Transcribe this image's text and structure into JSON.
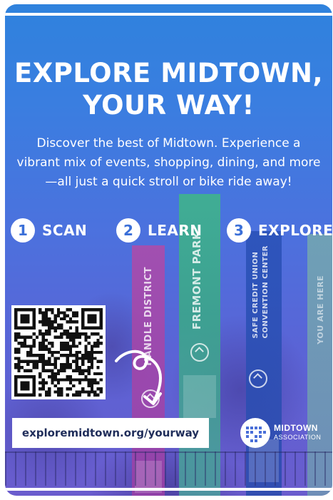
{
  "poster": {
    "title_line1": "EXPLORE MIDTOWN,",
    "title_line2": "YOUR WAY!",
    "subtitle": "Discover the best of Midtown. Experience a vibrant mix of events, shopping, dining, and more—all just a quick stroll or bike ride away!",
    "steps": [
      {
        "number": "1",
        "label": "SCAN"
      },
      {
        "number": "2",
        "label": "LEARN"
      },
      {
        "number": "3",
        "label": "EXPLORE"
      }
    ],
    "url": "exploremidtown.org/yourway",
    "logo": {
      "name": "MIDTOWN",
      "sub": "ASSOCIATION",
      "icon": "midtown-logo-icon"
    },
    "qr_icon": "qr-code",
    "arrow_icon": "curly-arrow-icon"
  },
  "background_signs": {
    "handle": "HANDLE DISTRICT",
    "fremont": "FREMONT PARK",
    "safe_line1": "SAFE CREDIT UNION",
    "safe_line2": "CONVENTION CENTER",
    "right": "YOU ARE HERE"
  },
  "colors": {
    "gradient_top": "#2f82dd",
    "gradient_bottom": "#6a5ccd",
    "text": "#ffffff",
    "url_text": "#1f2d5a"
  }
}
